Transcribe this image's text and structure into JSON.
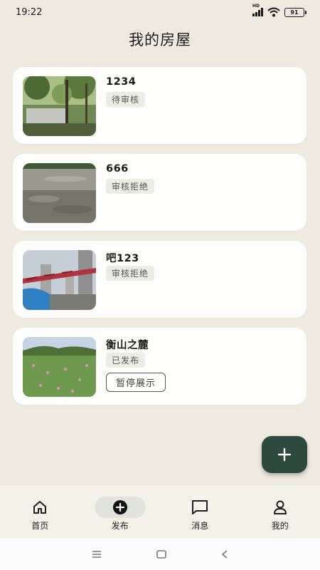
{
  "status_bar": {
    "time": "19:22",
    "network_label": "HD",
    "battery_level": "91"
  },
  "page": {
    "title": "我的房屋"
  },
  "houses": [
    {
      "title": "1234",
      "status": "待审核",
      "thumbnail": "garden-photo"
    },
    {
      "title": "666",
      "status": "审核拒绝",
      "thumbnail": "water-photo"
    },
    {
      "title": "吧123",
      "status": "审核拒绝",
      "thumbnail": "construction-photo"
    },
    {
      "title": "衡山之麓",
      "status": "已发布",
      "thumbnail": "field-photo",
      "action_label": "暂停展示"
    }
  ],
  "fab": {
    "icon": "plus-icon"
  },
  "bottom_nav": {
    "items": [
      {
        "label": "首页",
        "icon": "home-icon",
        "active": false
      },
      {
        "label": "发布",
        "icon": "add-circle-icon",
        "active": true
      },
      {
        "label": "消息",
        "icon": "message-icon",
        "active": false
      },
      {
        "label": "我的",
        "icon": "user-icon",
        "active": false
      }
    ]
  },
  "system_nav": {
    "icons": [
      "menu-icon",
      "home-square-icon",
      "back-icon"
    ]
  },
  "colors": {
    "background": "#efeae0",
    "card": "#fdfdfb",
    "accent": "#2c4a3d"
  }
}
